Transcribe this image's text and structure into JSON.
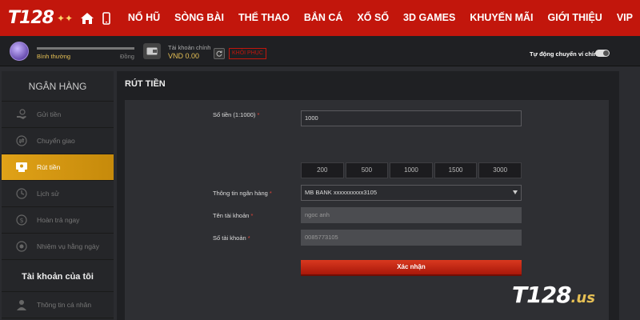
{
  "header": {
    "logo_text": "T128",
    "nav_items": [
      "NỔ HŨ",
      "SÒNG BÀI",
      "THỂ THAO",
      "BẮN CÁ",
      "XỔ SỐ",
      "3D GAMES",
      "KHUYẾN MÃI",
      "GIỚI THIỆU",
      "VIP"
    ],
    "accent_color": "#c2160c"
  },
  "userbar": {
    "level_name": "Bình thường",
    "level_next": "Đồng",
    "account_label": "Tài khoản chính",
    "account_balance": "VND 0.00",
    "restore_label": "KHÔI PHỤC",
    "auto_transfer_label": "Tự động chuyển ví chính"
  },
  "sidebar": {
    "section_bank": "NGÂN HÀNG",
    "bank_items": [
      {
        "label": "Gửi tiền",
        "icon": "deposit-icon",
        "active": false
      },
      {
        "label": "Chuyển giao",
        "icon": "transfer-icon",
        "active": false
      },
      {
        "label": "Rút tiền",
        "icon": "withdraw-icon",
        "active": true
      },
      {
        "label": "Lịch sử",
        "icon": "history-icon",
        "active": false
      },
      {
        "label": "Hoàn trả ngay",
        "icon": "refund-icon",
        "active": false
      },
      {
        "label": "Nhiệm vụ hằng ngày",
        "icon": "mission-icon",
        "active": false
      }
    ],
    "section_account": "Tài khoản của tôi",
    "account_items": [
      {
        "label": "Thông tin cá nhân",
        "icon": "user-icon"
      }
    ],
    "active_color": "#e0a218"
  },
  "main": {
    "title": "RÚT TIỀN",
    "amount_label": "Số tiền (1:1000)",
    "amount_value": "1000",
    "amount_options": [
      "200",
      "500",
      "1000",
      "1500",
      "3000"
    ],
    "bank_label": "Thông tin ngân hàng",
    "bank_value": "MB BANK xxxxxxxxxx3105",
    "account_name_label": "Tên tài khoản",
    "account_name_value": "ngoc anh",
    "account_number_label": "Số tài khoản",
    "account_number_value": "0085773105",
    "required_mark": "*",
    "confirm_label": "Xác nhận"
  },
  "watermark": {
    "main": "T128",
    "suffix": ".us"
  }
}
